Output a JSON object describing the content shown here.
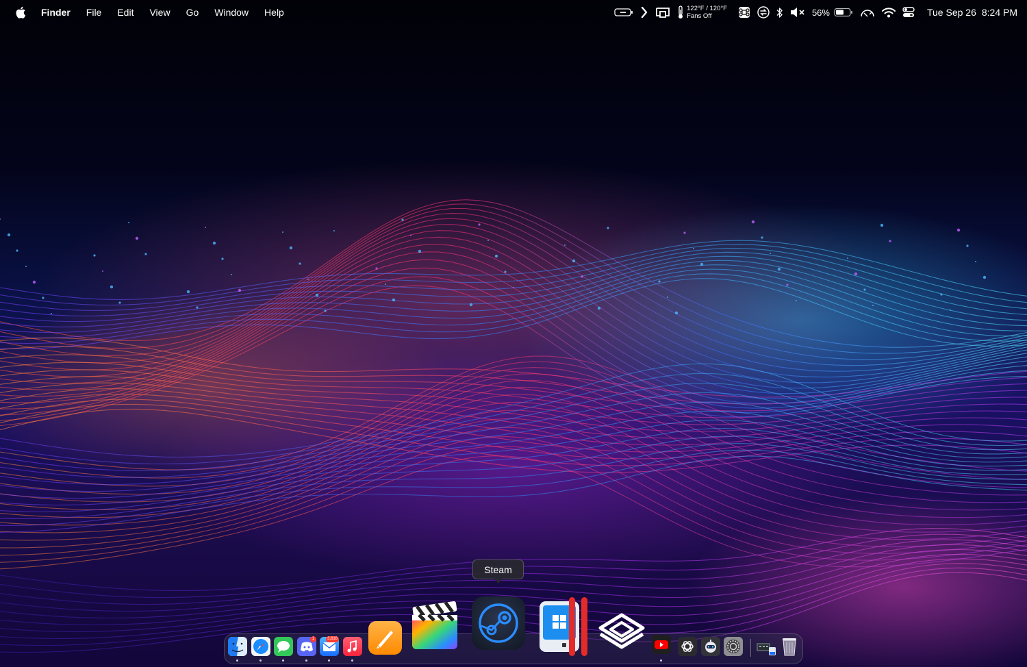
{
  "menubar": {
    "app_name": "Finder",
    "menus": [
      "File",
      "Edit",
      "View",
      "Go",
      "Window",
      "Help"
    ],
    "status": {
      "temperature": "122°F / 120°F",
      "fans": "Fans Off",
      "battery_percent": "56%",
      "date": "Tue Sep 26",
      "time": "8:24 PM"
    }
  },
  "tooltip": {
    "label": "Steam"
  },
  "dock": {
    "apps": [
      {
        "name": "Finder",
        "running": true
      },
      {
        "name": "Safari",
        "running": true
      },
      {
        "name": "Messages",
        "running": true
      },
      {
        "name": "Discord",
        "running": true,
        "badge": "1"
      },
      {
        "name": "Mail",
        "running": true,
        "badge": "3,616"
      },
      {
        "name": "Music",
        "running": true
      },
      {
        "name": "Pages",
        "running": false
      },
      {
        "name": "Final Cut Pro",
        "running": false
      },
      {
        "name": "Steam",
        "running": false
      },
      {
        "name": "Parallels Desktop",
        "running": false
      },
      {
        "name": "Layers",
        "running": false
      },
      {
        "name": "YouTube",
        "running": true
      },
      {
        "name": "ChatGPT",
        "running": false
      },
      {
        "name": "Robot App",
        "running": false
      },
      {
        "name": "System Settings",
        "running": false
      },
      {
        "name": "Downloads Stack",
        "running": false
      },
      {
        "name": "Trash",
        "running": false
      }
    ]
  },
  "colors": {
    "menu_text": "#ffffff",
    "parallels_red": "#e52a2a",
    "steam_blue": "#2a8cff"
  }
}
